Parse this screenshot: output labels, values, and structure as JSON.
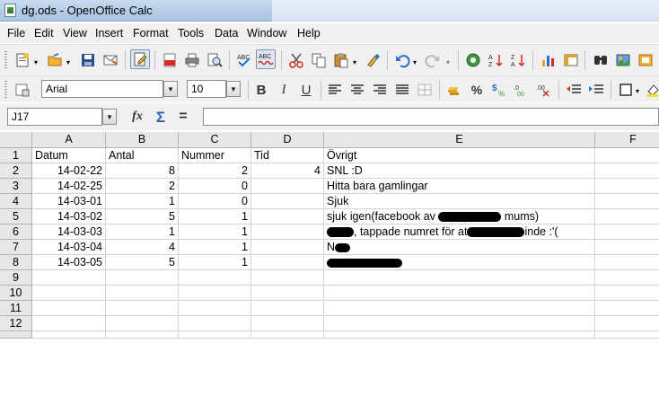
{
  "window": {
    "title": "dg.ods - OpenOffice Calc"
  },
  "menu": [
    "File",
    "Edit",
    "View",
    "Insert",
    "Format",
    "Tools",
    "Data",
    "Window",
    "Help"
  ],
  "toolbar_standard": [
    "new-icon",
    "open-icon",
    "save-icon",
    "email-icon",
    "edit-file-icon",
    "export-pdf-icon",
    "print-icon",
    "page-preview-icon",
    "spellcheck-icon",
    "autospellcheck-icon",
    "cut-icon",
    "copy-icon",
    "paste-icon",
    "clone-format-icon",
    "undo-icon",
    "redo-icon",
    "navigator-icon",
    "sort-ascending-icon",
    "sort-descending-icon",
    "chart-icon",
    "find-icon",
    "gallery-icon"
  ],
  "formatting": {
    "font_name": "Arial",
    "font_size": "10",
    "bold": "B",
    "italic": "I",
    "underline": "U",
    "currency": "%",
    "percent_label": "%"
  },
  "formula_bar": {
    "name_box": "J17",
    "function_wizard": "fx",
    "sum": "Σ",
    "equals": "=",
    "input": ""
  },
  "sheet": {
    "columns": [
      "A",
      "B",
      "C",
      "D",
      "E",
      "F"
    ],
    "rows": [
      "1",
      "2",
      "3",
      "4",
      "5",
      "6",
      "7",
      "8",
      "9",
      "10",
      "11",
      "12"
    ],
    "header_row": [
      "Datum",
      "Antal",
      "Nummer",
      "Tid",
      "Övrigt"
    ],
    "data": [
      [
        "14-02-22",
        "8",
        "2",
        "4",
        "SNL :D"
      ],
      [
        "14-02-25",
        "2",
        "0",
        "",
        "Hitta bara gamlingar"
      ],
      [
        "14-03-01",
        "1",
        "0",
        "",
        "Sjuk"
      ],
      [
        "14-03-02",
        "5",
        "1",
        "",
        "sjuk igen(facebook av",
        "mums)"
      ],
      [
        "14-03-03",
        "1",
        "1",
        "",
        ", tappade numret för at",
        "inde :'("
      ],
      [
        "14-03-04",
        "4",
        "1",
        "",
        "N"
      ],
      [
        "14-03-05",
        "5",
        "1",
        "",
        ""
      ]
    ]
  }
}
